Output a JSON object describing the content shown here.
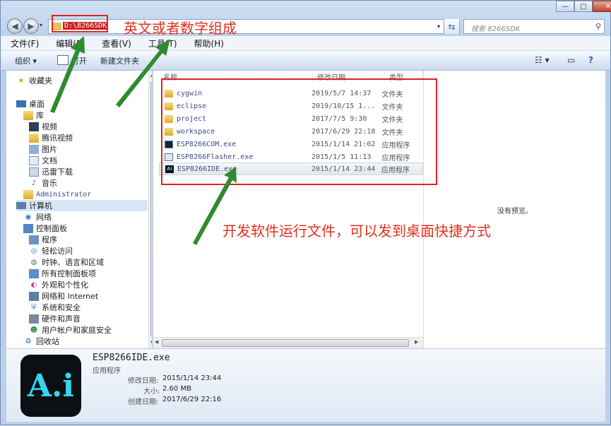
{
  "window": {
    "address": "D:\\8266SDK",
    "search_placeholder": "搜索 8266SDK",
    "minimize": "—",
    "maximize": "□",
    "close": "✕"
  },
  "annotations": {
    "address_note": "英文或者数字组成",
    "list_note": "开发软件运行文件，可以发到桌面快捷方式"
  },
  "menu": [
    "文件(F)",
    "编辑(E)",
    "查看(V)",
    "工具(T)",
    "帮助(H)"
  ],
  "toolbar": {
    "organize": "组织 ▾",
    "open": "打开",
    "new_folder": "新建文件夹"
  },
  "nav": {
    "favorites": "收藏夹",
    "desktop": "桌面",
    "libraries": "库",
    "videos": "视频",
    "tencent_video": "腾讯视频",
    "pictures": "图片",
    "documents": "文档",
    "xunlei": "迅雷下载",
    "music": "音乐",
    "administrator": "Administrator",
    "computer": "计算机",
    "network": "网络",
    "control_panel": "控制面板",
    "programs": "程序",
    "ease": "轻松访问",
    "clock": "时钟、语言和区域",
    "all_cp": "所有控制面板项",
    "appearance": "外观和个性化",
    "net_internet": "网络和 Internet",
    "system_security": "系统和安全",
    "hardware_sound": "硬件和声音",
    "user_accounts": "用户帐户和家庭安全",
    "recycle": "回收站"
  },
  "columns": {
    "name": "名称",
    "date": "修改日期",
    "type": "类型"
  },
  "files": [
    {
      "name": "cygwin",
      "date": "2019/5/7 14:37",
      "type": "文件夹",
      "icon": "folder"
    },
    {
      "name": "eclipse",
      "date": "2019/10/15 1...",
      "type": "文件夹",
      "icon": "folder"
    },
    {
      "name": "project",
      "date": "2017/7/5 9:30",
      "type": "文件夹",
      "icon": "folder"
    },
    {
      "name": "workspace",
      "date": "2017/6/29 22:18",
      "type": "文件夹",
      "icon": "folder"
    },
    {
      "name": "ESP8266COM.exe",
      "date": "2015/1/14 21:02",
      "type": "应用程序",
      "icon": "exe-com"
    },
    {
      "name": "ESP8266Flasher.exe",
      "date": "2015/1/5 11:13",
      "type": "应用程序",
      "icon": "exe-flasher"
    },
    {
      "name": "ESP8266IDE.exe",
      "date": "2015/1/14 23:44",
      "type": "应用程序",
      "icon": "exe-ide"
    }
  ],
  "preview": {
    "empty": "没有预览。"
  },
  "details": {
    "filename": "ESP8266IDE.exe",
    "filetype": "应用程序",
    "modified_label": "修改日期:",
    "modified": "2015/1/14 23:44",
    "size_label": "大小:",
    "size": "2.60 MB",
    "created_label": "创建日期:",
    "created": "2017/6/29 22:16",
    "icon_text": "A.i"
  },
  "colors": {
    "annotation": "#e0301e",
    "arrow": "#2e8b2e",
    "box": "#e02020"
  }
}
